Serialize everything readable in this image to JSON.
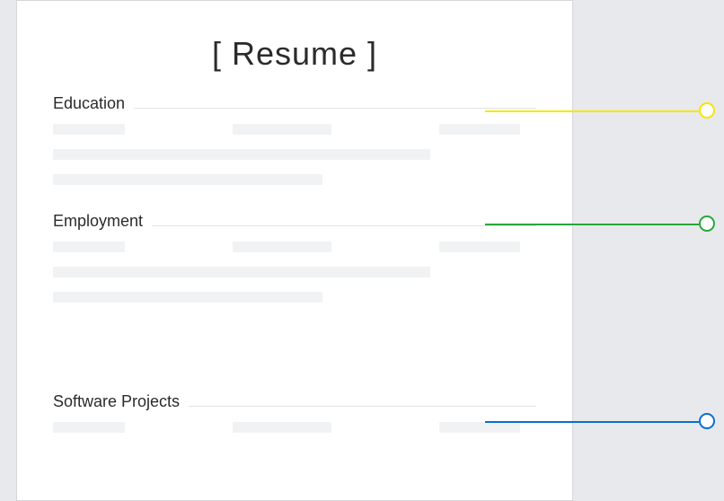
{
  "title": "[ Resume ]",
  "sections": {
    "education": {
      "heading": "Education"
    },
    "employment": {
      "heading": "Employment"
    },
    "software_projects": {
      "heading": "Software Projects"
    }
  },
  "callouts": {
    "education": {
      "color": "#f7e600"
    },
    "employment": {
      "color": "#29a63a"
    },
    "software_projects": {
      "color": "#0a6ed1"
    }
  }
}
